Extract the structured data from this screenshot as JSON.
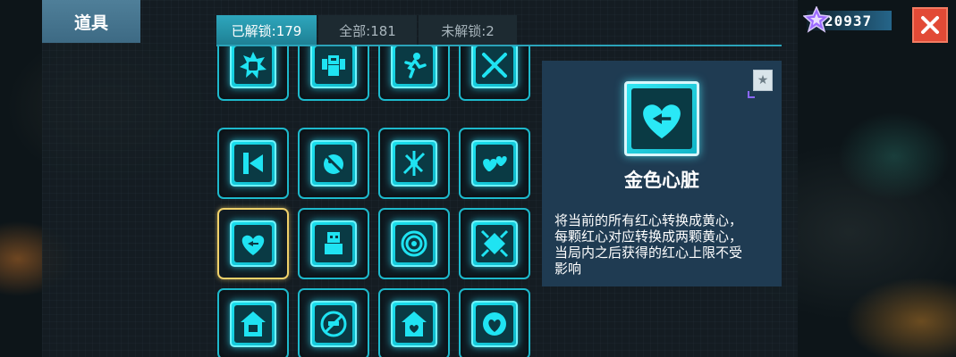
{
  "header": {
    "title": "道具"
  },
  "tabs": [
    {
      "label": "已解锁:179",
      "active": true
    },
    {
      "label": "全部:181",
      "active": false
    },
    {
      "label": "未解锁:2",
      "active": false
    }
  ],
  "currency": {
    "icon": "purple-star-icon",
    "value": "20937"
  },
  "close": {
    "icon": "close-icon"
  },
  "items": [
    {
      "icon": "fist-burst-icon"
    },
    {
      "icon": "muscle-robot-icon"
    },
    {
      "icon": "running-man-icon"
    },
    {
      "icon": "crossed-swords-icon"
    },
    {
      "icon": "arrow-flag-icon"
    },
    {
      "icon": "ball-bat-icon"
    },
    {
      "icon": "scatter-arrows-icon"
    },
    {
      "icon": "hearts-icon"
    },
    {
      "icon": "golden-heart-icon",
      "selected": true
    },
    {
      "icon": "robot-block-icon"
    },
    {
      "icon": "target-rings-icon"
    },
    {
      "icon": "diamond-arrows-icon"
    },
    {
      "icon": "house-robot-icon"
    },
    {
      "icon": "no-entry-pistol-icon"
    },
    {
      "icon": "house-heart-icon"
    },
    {
      "icon": "shield-heart-icon"
    }
  ],
  "detail": {
    "icon": "golden-heart-icon",
    "name": "金色心脏",
    "description_lines": [
      "将当前的所有红心转换成黄心，",
      "每颗红心对应转换成两颗黄心，",
      "当局内之后获得的红心上限不受",
      "影响"
    ],
    "share_icon": "star-badge-icon"
  },
  "colors": {
    "accent": "#1db9cc",
    "selected_border": "#f0d16a",
    "detail_bg": "#1f3b52",
    "title_tab": "#4a7b96",
    "close": "#e24a36"
  }
}
